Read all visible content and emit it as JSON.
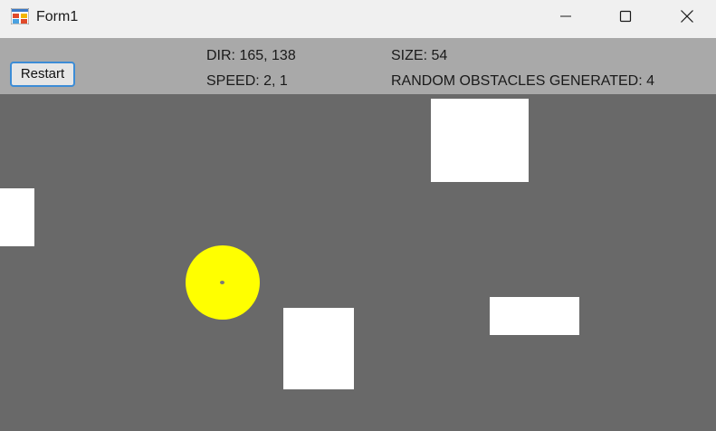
{
  "window": {
    "title": "Form1",
    "icon": "winforms-app-icon",
    "controls": [
      "minimize-icon",
      "maximize-icon",
      "close-icon"
    ]
  },
  "toolbar": {
    "restart_label": "Restart",
    "dir_text": "DIR: 165, 138",
    "speed_text": "SPEED: 2, 1",
    "size_text": "SIZE: 54",
    "obstacles_text": "RANDOM OBSTACLES GENERATED: 4"
  },
  "game": {
    "ball_color": "#ffff00",
    "background_color": "#696969",
    "obstacle_color": "#ffffff",
    "toolbar_color": "#a9a9a9"
  }
}
